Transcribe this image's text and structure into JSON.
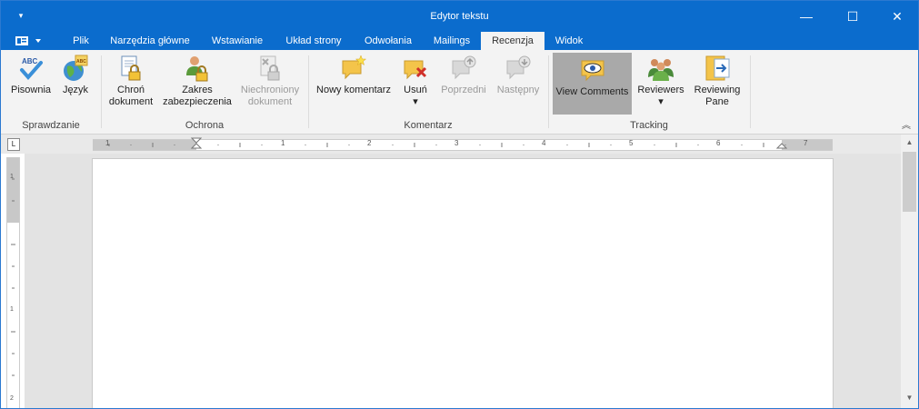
{
  "window": {
    "title": "Edytor tekstu",
    "minimize": "—",
    "maximize": "☐",
    "close": "✕"
  },
  "quick_access": {
    "menu_glyph": "▾"
  },
  "tabs": [
    {
      "label": "Plik"
    },
    {
      "label": "Narzędzia główne"
    },
    {
      "label": "Wstawianie"
    },
    {
      "label": "Układ strony"
    },
    {
      "label": "Odwołania"
    },
    {
      "label": "Mailings"
    },
    {
      "label": "Recenzja",
      "active": true
    },
    {
      "label": "Widok"
    }
  ],
  "ribbon": {
    "groups": {
      "sprawdzanie": "Sprawdzanie",
      "ochrona": "Ochrona",
      "komentarz": "Komentarz",
      "tracking": "Tracking"
    },
    "buttons": {
      "pisownia": "Pisownia",
      "jezyk": "Język",
      "chron1": "Chroń",
      "chron2": "dokument",
      "zakres1": "Zakres",
      "zakres2": "zabezpieczenia",
      "niechr1": "Niechroniony",
      "niechr2": "dokument",
      "nowy": "Nowy komentarz",
      "usun": "Usuń",
      "poprzedni": "Poprzedni",
      "nastepny": "Następny",
      "view": "View Comments",
      "reviewers": "Reviewers",
      "revpane1": "Reviewing",
      "revpane2": "Pane"
    },
    "dropdown_arrow": "▾",
    "collapse_glyph": "︽"
  },
  "ruler": {
    "h_labels": [
      "1",
      "1",
      "2",
      "3",
      "4",
      "5",
      "6",
      "7"
    ],
    "v_labels": [
      "1",
      "1",
      "2"
    ],
    "corner_glyph": "L"
  },
  "colors": {
    "accent": "#0b6ccd",
    "ribbon_bg": "#f3f3f3",
    "pressed": "#a9a9a9"
  }
}
